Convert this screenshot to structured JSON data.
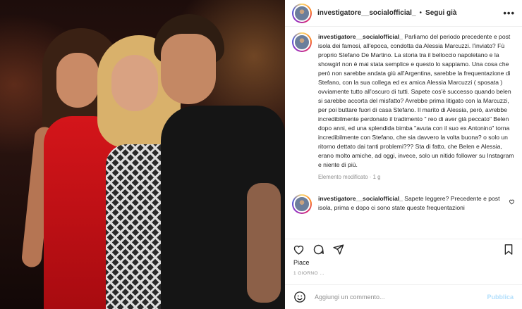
{
  "header": {
    "username": "investigatore__socialofficial_",
    "separator": "•",
    "follow_label": "Segui già",
    "more_label": "•••"
  },
  "caption": {
    "username": "investigatore__socialofficial_",
    "text": " Parliamo del periodo precedente e post isola dei famosi, all'epoca, condotta da Alessia Marcuzzi. l'inviato? Fù proprio Stefano De Martino. La storia tra il belloccio napoletano e la showgirl non è mai stata semplice e questo lo sappiamo. Una cosa che però non sarebbe andata giù all'Argentina, sarebbe la frequentazione di Stefano, con la sua collega ed ex amica Alessia Marcuzzi ( sposata ) ovviamente tutto all'oscuro di tutti. Sapete cos'è successo quando belen si sarebbe accorta del misfatto? Avrebbe prima litigato con la Marcuzzi, per poi buttare fuori di casa Stefano. Il marito di Alessia, però, avrebbe incredibilmente perdonato il tradimento \" reo di aver già peccato\" Belen dopo anni, ed una splendida bimba \"avuta con il suo ex Antonino\" torna incredibilmente con Stefano, che sia davvero la volta buona? o solo un ritorno dettato dai tanti problemi??? Sta di fatto, che Belen e Alessia, erano molto amiche, ad oggi, invece, solo un nitido follower su Instagram e niente di più.",
    "meta": "Elemento modificato · 1 g"
  },
  "comment": {
    "username": "investigatore__socialofficial_",
    "text": " Sapete leggere? Precedente e post isola, prima e dopo ci sono state queste frequentazioni"
  },
  "actions": {
    "like_icon": "heart-icon",
    "comment_icon": "comment-icon",
    "share_icon": "share-icon",
    "save_icon": "bookmark-icon"
  },
  "likes_text": "Piace",
  "date_text": "1 GIORNO …",
  "add_comment": {
    "placeholder": "Aggiungi un commento...",
    "publish_label": "Pubblica"
  },
  "colors": {
    "publish_disabled": "#b2dffc",
    "muted": "#8e8e8e",
    "text": "#262626"
  }
}
